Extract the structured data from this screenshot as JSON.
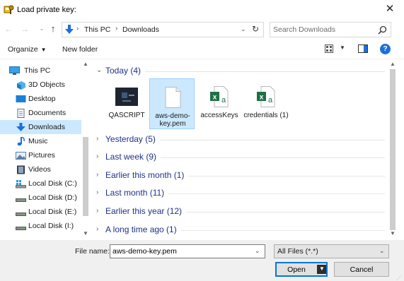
{
  "window": {
    "title": "Load private key:",
    "close_glyph": "✕"
  },
  "address": {
    "crumbs": [
      "This PC",
      "Downloads"
    ],
    "separator": "›"
  },
  "search": {
    "placeholder": "Search Downloads"
  },
  "toolbar": {
    "organize_label": "Organize",
    "new_folder_label": "New folder",
    "help_glyph": "?"
  },
  "nav_pane": {
    "items": [
      {
        "label": "This PC",
        "icon": "monitor-icon"
      },
      {
        "label": "3D Objects",
        "icon": "3d-objects-icon"
      },
      {
        "label": "Desktop",
        "icon": "desktop-icon"
      },
      {
        "label": "Documents",
        "icon": "documents-icon"
      },
      {
        "label": "Downloads",
        "icon": "downloads-icon",
        "selected": true
      },
      {
        "label": "Music",
        "icon": "music-icon"
      },
      {
        "label": "Pictures",
        "icon": "pictures-icon"
      },
      {
        "label": "Videos",
        "icon": "videos-icon"
      },
      {
        "label": "Local Disk (C:)",
        "icon": "drive-icon"
      },
      {
        "label": "Local Disk (D:)",
        "icon": "drive-icon"
      },
      {
        "label": "Local Disk (E:)",
        "icon": "drive-icon"
      },
      {
        "label": "Local Disk (I:)",
        "icon": "drive-icon"
      }
    ]
  },
  "groups": [
    {
      "label": "Today (4)",
      "expanded": true
    },
    {
      "label": "Yesterday (5)",
      "expanded": false
    },
    {
      "label": "Last week (9)",
      "expanded": false
    },
    {
      "label": "Earlier this month (1)",
      "expanded": false
    },
    {
      "label": "Last month (11)",
      "expanded": false
    },
    {
      "label": "Earlier this year (12)",
      "expanded": false
    },
    {
      "label": "A long time ago (1)",
      "expanded": false
    }
  ],
  "chevrons": {
    "expanded": "⌄",
    "collapsed": "›"
  },
  "files": [
    {
      "name": "QASCRIPT",
      "icon": "video-thumbnail-icon"
    },
    {
      "name": "aws-demo-key.pem",
      "icon": "blank-file-icon",
      "selected": true
    },
    {
      "name": "accessKeys",
      "icon": "excel-csv-icon"
    },
    {
      "name": "credentials (1)",
      "icon": "excel-csv-icon"
    }
  ],
  "bottom": {
    "file_name_label": "File name:",
    "file_name_value": "aws-demo-key.pem",
    "filter_label": "All Files (*.*)",
    "open_label": "Open",
    "cancel_label": "Cancel"
  },
  "colors": {
    "accent": "#0078d7",
    "selection": "#cce8ff",
    "group_header": "#1e3287",
    "excel_green": "#1e7145"
  }
}
